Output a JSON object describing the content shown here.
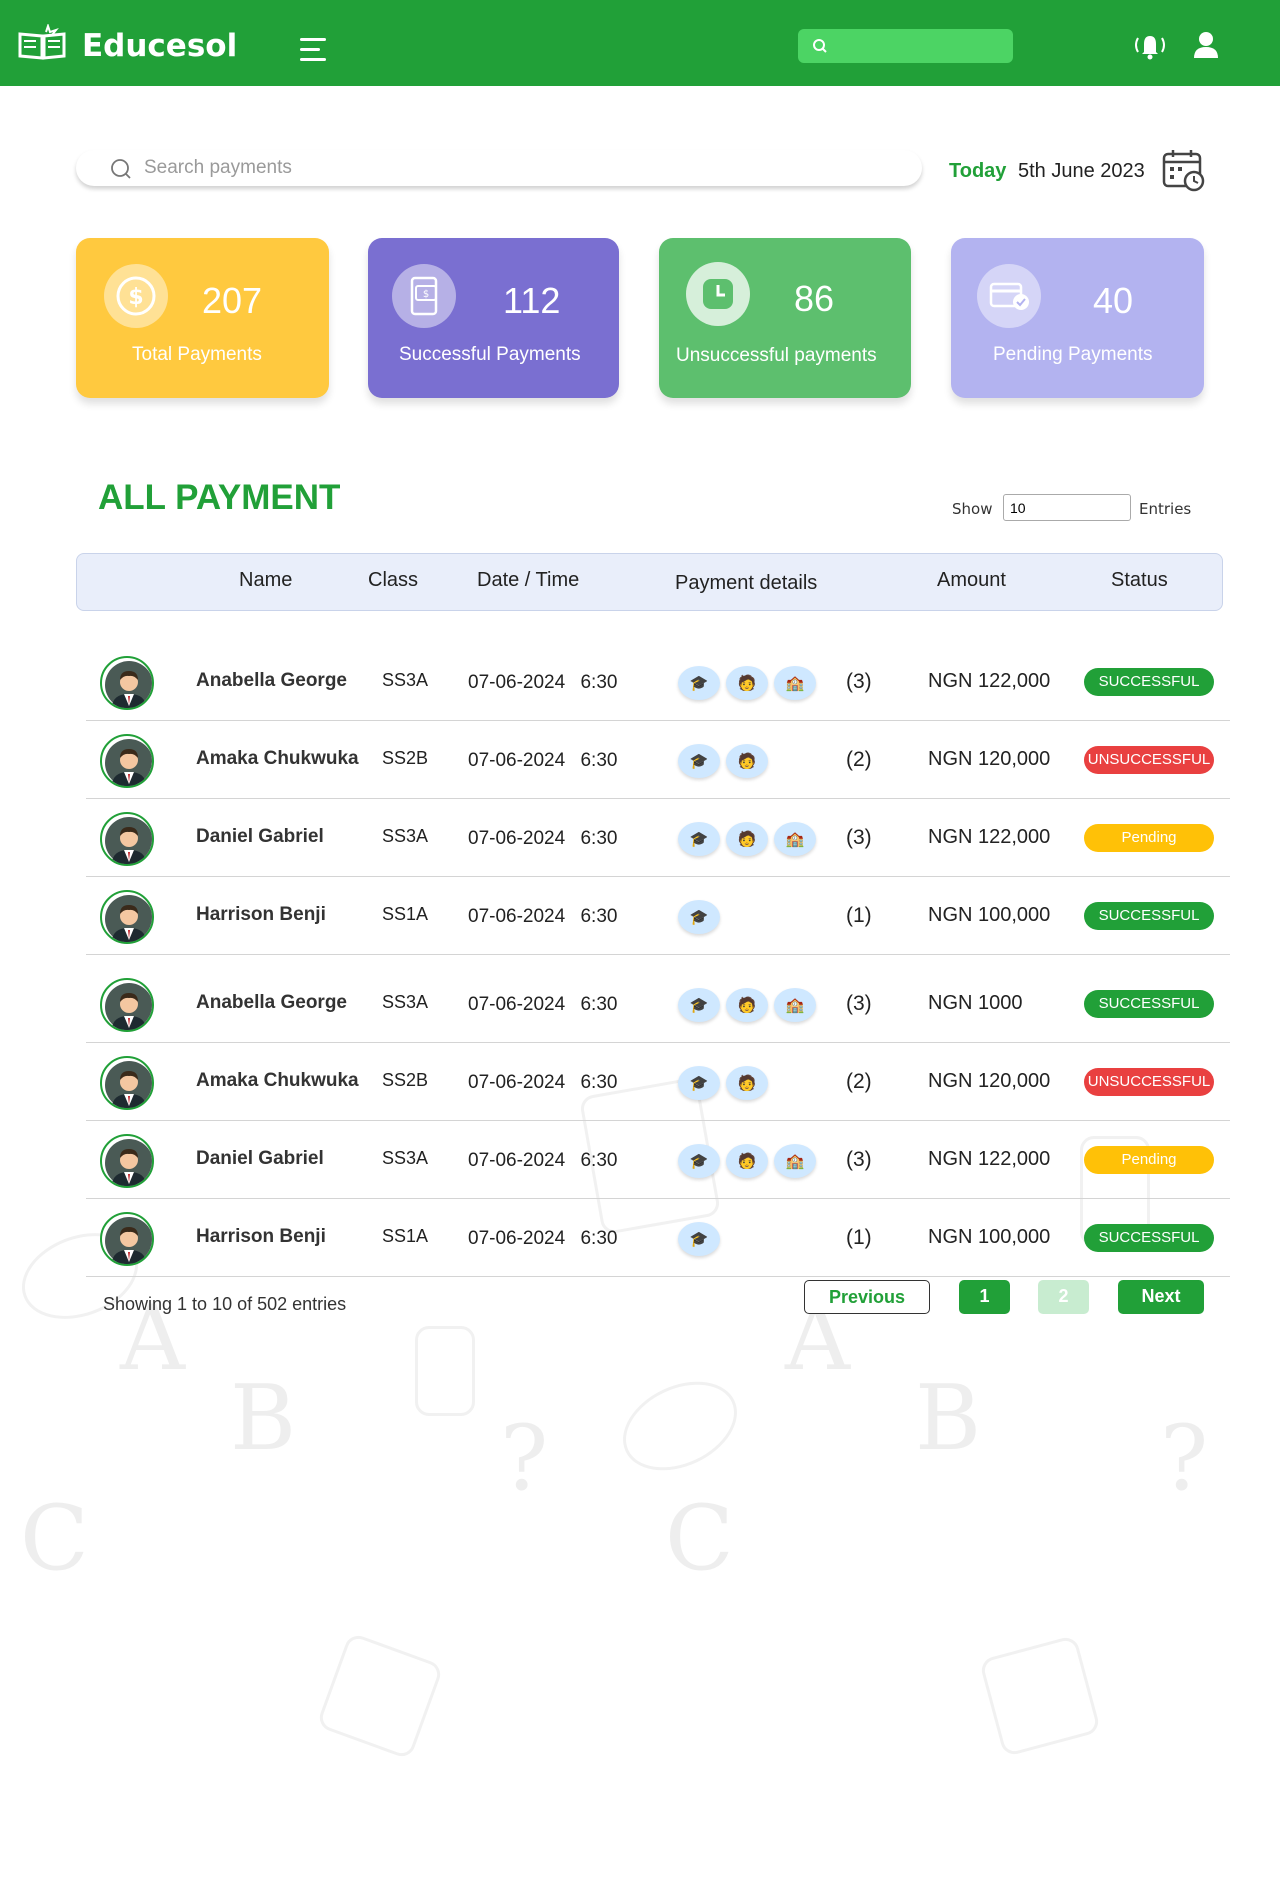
{
  "header": {
    "brand": "Educesol",
    "search_placeholder": ""
  },
  "search": {
    "placeholder": "Search payments"
  },
  "date": {
    "today_label": "Today",
    "value": "5th June 2023"
  },
  "stats": [
    {
      "value": "207",
      "label": "Total Payments",
      "color": "#ffc93f"
    },
    {
      "value": "112",
      "label": "Successful Payments",
      "color": "#7a6fd1"
    },
    {
      "value": "86",
      "label": "Unsuccessful payments",
      "color": "#5dbf6e"
    },
    {
      "value": "40",
      "label": "Pending Payments",
      "color": "#b3b3f0"
    }
  ],
  "section": {
    "title": "ALL PAYMENT",
    "show_label": "Show",
    "show_value": "10",
    "entries_label": "Entries"
  },
  "table": {
    "headers": {
      "name": "Name",
      "class": "Class",
      "datetime": "Date / Time",
      "details": "Payment details",
      "amount": "Amount",
      "status": "Status"
    },
    "rows": [
      {
        "name": "Anabella George",
        "class": "SS3A",
        "datetime": "07-06-2024 6:30",
        "count": "(3)",
        "amount": "NGN 122,000",
        "status": "SUCCESSFUL"
      },
      {
        "name": "Amaka Chukwuka",
        "class": "SS2B",
        "datetime": "07-06-2024 6:30",
        "count": "(2)",
        "amount": "NGN 120,000",
        "status": "UNSUCCESSFUL"
      },
      {
        "name": "Daniel Gabriel",
        "class": "SS3A",
        "datetime": "07-06-2024 6:30",
        "count": "(3)",
        "amount": "NGN 122,000",
        "status": "Pending"
      },
      {
        "name": "Harrison Benji",
        "class": "SS1A",
        "datetime": "07-06-2024 6:30",
        "count": "(1)",
        "amount": "NGN 100,000",
        "status": "SUCCESSFUL"
      },
      {
        "name": "Anabella George",
        "class": "SS3A",
        "datetime": "07-06-2024 6:30",
        "count": "(3)",
        "amount": "NGN 1000",
        "status": "SUCCESSFUL"
      },
      {
        "name": "Amaka Chukwuka",
        "class": "SS2B",
        "datetime": "07-06-2024 6:30",
        "count": "(2)",
        "amount": "NGN 120,000",
        "status": "UNSUCCESSFUL"
      },
      {
        "name": "Daniel Gabriel",
        "class": "SS3A",
        "datetime": "07-06-2024 6:30",
        "count": "(3)",
        "amount": "NGN 122,000",
        "status": "Pending"
      },
      {
        "name": "Harrison Benji",
        "class": "SS1A",
        "datetime": "07-06-2024 6:30",
        "count": "(1)",
        "amount": "NGN 100,000",
        "status": "SUCCESSFUL"
      }
    ]
  },
  "status_colors": {
    "SUCCESSFUL": "#21a038",
    "UNSUCCESSFUL": "#e94040",
    "Pending": "#ffc107"
  },
  "pagination": {
    "showing": "Showing 1 to 10 of 502 entries",
    "previous": "Previous",
    "page1": "1",
    "page2": "2",
    "next": "Next"
  },
  "icons": {
    "logo": "book-icon",
    "menu": "hamburger-icon",
    "search": "search-icon",
    "bell": "bell-icon",
    "user": "user-icon",
    "calendar": "calendar-icon",
    "payment_details": [
      "graduation-cap-icon",
      "student-icon",
      "school-icon"
    ]
  },
  "colors": {
    "primary": "#21a038"
  }
}
